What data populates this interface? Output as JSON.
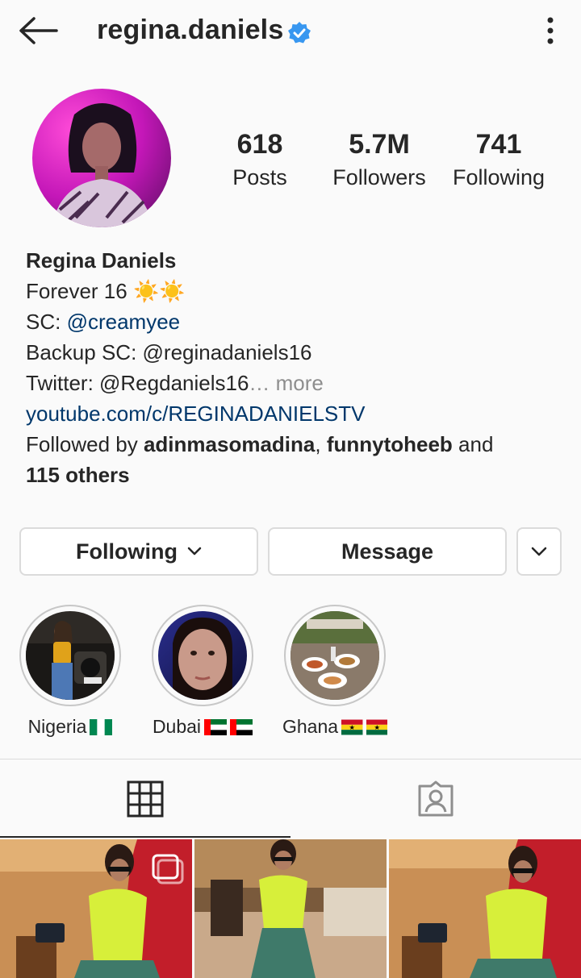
{
  "header": {
    "username": "regina.daniels",
    "back_icon": "arrow-left-icon",
    "verified_icon": "verified-badge-icon",
    "more_icon": "more-vertical-icon"
  },
  "stats": {
    "posts": {
      "value": "618",
      "label": "Posts"
    },
    "followers": {
      "value": "5.7M",
      "label": "Followers"
    },
    "following": {
      "value": "741",
      "label": "Following"
    }
  },
  "bio": {
    "name": "Regina Daniels",
    "line1_text": "Forever 16 ",
    "line1_emoji": "☀️☀️",
    "sc_prefix": "SC: ",
    "sc_handle": "@creamyee",
    "backup": "Backup SC: @reginadaniels16",
    "twitter": "Twitter: @Regdaniels16",
    "more": "… more",
    "website": "youtube.com/c/REGINADANIELSTV",
    "followed_by_prefix": "Followed by ",
    "follower1": "adinmasomadina",
    "separator": ", ",
    "follower2": "funnytoheeb",
    "and": " and",
    "others": "115 others"
  },
  "actions": {
    "following_label": "Following",
    "message_label": "Message"
  },
  "highlights": [
    {
      "label": "Nigeria",
      "flags": [
        "nigeria"
      ]
    },
    {
      "label": "Dubai",
      "flags": [
        "uae",
        "uae"
      ]
    },
    {
      "label": "Ghana",
      "flags": [
        "ghana",
        "ghana"
      ]
    }
  ],
  "tabs": {
    "grid_icon": "grid-icon",
    "tagged_icon": "tagged-person-icon",
    "active": "grid"
  },
  "colors": {
    "link": "#00376b",
    "verified": "#3897f0",
    "muted": "#8e8e8e",
    "border": "#dbdbdb"
  }
}
